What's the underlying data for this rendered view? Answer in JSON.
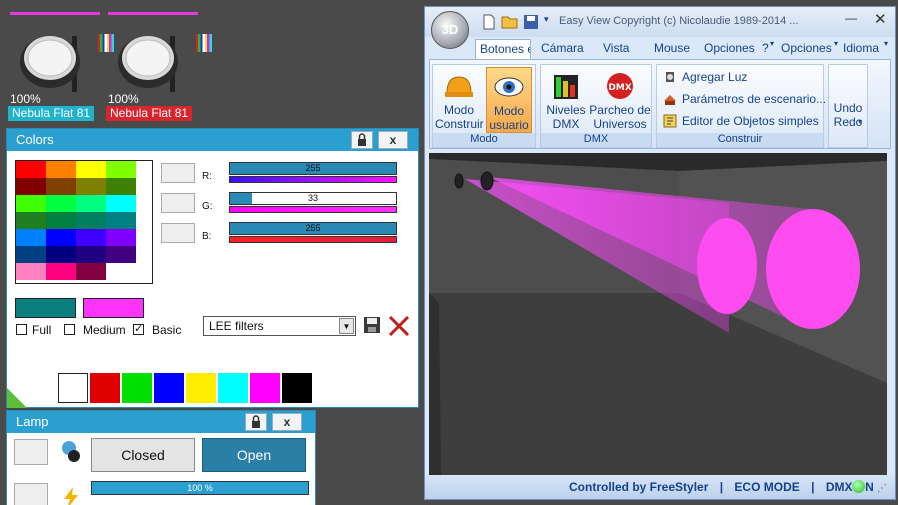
{
  "fixtures": [
    {
      "percent": "100%",
      "name": "Nebula Flat 81",
      "name_color": "#1fb4cc"
    },
    {
      "percent": "100%",
      "name": "Nebula Flat 81",
      "name_color": "#d8242c"
    }
  ],
  "colors_panel": {
    "title": "Colors",
    "close_label": "x",
    "channels": [
      {
        "label": "R:",
        "value": "255",
        "level": 1.0
      },
      {
        "label": "G:",
        "value": "33",
        "level": 0.13
      },
      {
        "label": "B:",
        "value": "255",
        "level": 1.0
      }
    ],
    "current_color": "#0b7f7f",
    "preview_color": "#ff33ff",
    "options": [
      {
        "label": "Full",
        "checked": false
      },
      {
        "label": "Medium",
        "checked": false
      },
      {
        "label": "Basic",
        "checked": true
      }
    ],
    "filter_select": "LEE filters",
    "grid_colors": [
      [
        "#ff0000",
        "#ff8000",
        "#ffff00",
        "#80ff00"
      ],
      [
        "#800000",
        "#804000",
        "#808000",
        "#408000"
      ],
      [
        "#40ff00",
        "#00ff40",
        "#00ff80",
        "#00ffff"
      ],
      [
        "#208020",
        "#008040",
        "#008060",
        "#008080"
      ],
      [
        "#0080ff",
        "#0000ff",
        "#4000ff",
        "#8000ff"
      ],
      [
        "#004080",
        "#000080",
        "#200080",
        "#400080"
      ],
      [
        "#ff80c0",
        "#ff0080",
        "#800040",
        "#ffffff"
      ]
    ],
    "palette": [
      "#ffffff",
      "#e00000",
      "#00e000",
      "#0000ff",
      "#ffee00",
      "#00ffff",
      "#ff00ff",
      "#000000"
    ]
  },
  "lamp_panel": {
    "title": "Lamp",
    "close_label": "x",
    "closed_label": "Closed",
    "open_label": "Open",
    "dimmer_value": "100 %",
    "dimmer_level": 1.0
  },
  "window": {
    "title": "Easy View   Copyright (c) Nicolaudie 1989-2014 ...",
    "orb_label": "3D",
    "tabs": [
      "Botones e",
      "Cámara",
      "Vista",
      "Mouse",
      "Opciones",
      "?",
      "Opciones",
      "Idioma"
    ],
    "groups": [
      {
        "name": "Modo",
        "buttons": [
          "Modo Construir",
          "Modo usuario"
        ]
      },
      {
        "name": "DMX",
        "buttons": [
          "Niveles DMX",
          "Parcheo de Universos"
        ]
      },
      {
        "name": "Construir",
        "items": [
          "Agregar Luz",
          "Parámetros de escenario...",
          "Editor de Objetos simples"
        ]
      }
    ],
    "undo_label": "Undo Redo",
    "status": {
      "controlled": "Controlled by FreeStyler",
      "eco": "ECO MODE",
      "dmx": "DMX ON"
    }
  }
}
